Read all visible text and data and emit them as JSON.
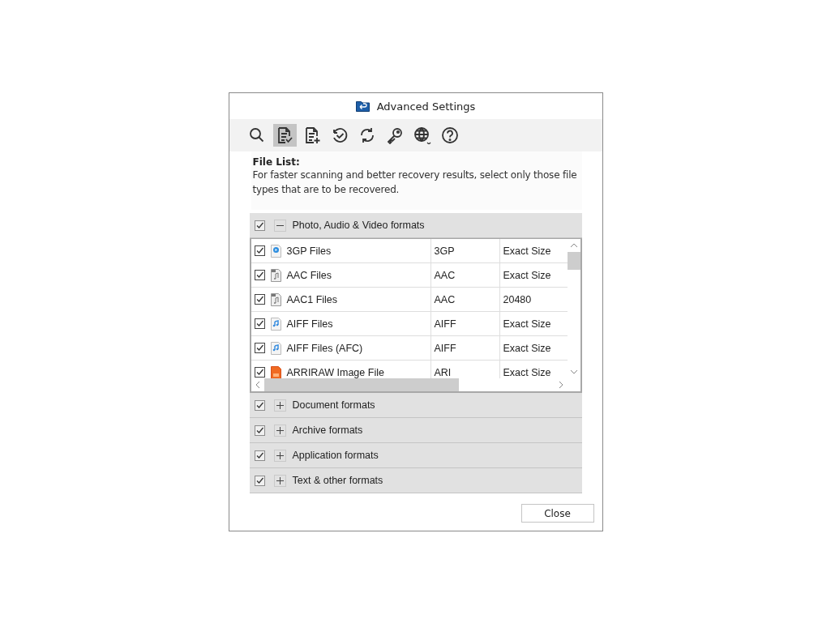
{
  "window": {
    "title": "Advanced Settings"
  },
  "toolbar": [
    {
      "selected": false
    },
    {
      "selected": true
    },
    {
      "selected": false
    },
    {
      "selected": false
    },
    {
      "selected": false
    },
    {
      "selected": false
    },
    {
      "selected": false
    },
    {
      "selected": false
    }
  ],
  "intro": {
    "heading": "File List:",
    "text": "For faster scanning and better recovery results, select only those file types that are to be recovered."
  },
  "groups": [
    {
      "label": "Photo, Audio & Video formats",
      "checked": true,
      "expanded": true,
      "rows": [
        {
          "name": "3GP Files",
          "type": "3GP",
          "size": "Exact Size",
          "checked": true,
          "kind": "video"
        },
        {
          "name": "AAC Files",
          "type": "AAC",
          "size": "Exact Size",
          "checked": true,
          "kind": "audio"
        },
        {
          "name": "AAC1 Files",
          "type": "AAC",
          "size": "20480",
          "checked": true,
          "kind": "audio"
        },
        {
          "name": "AIFF Files",
          "type": "AIFF",
          "size": "Exact Size",
          "checked": true,
          "kind": "music"
        },
        {
          "name": "AIFF Files (AFC)",
          "type": "AIFF",
          "size": "Exact Size",
          "checked": true,
          "kind": "music"
        },
        {
          "name": "ARRIRAW Image File",
          "type": "ARI",
          "size": "Exact Size",
          "checked": true,
          "kind": "image"
        }
      ]
    },
    {
      "label": "Document formats",
      "checked": true,
      "expanded": false
    },
    {
      "label": "Archive formats",
      "checked": true,
      "expanded": false
    },
    {
      "label": "Application formats",
      "checked": true,
      "expanded": false
    },
    {
      "label": "Text & other formats",
      "checked": true,
      "expanded": false
    }
  ],
  "buttons": {
    "close": "Close"
  }
}
